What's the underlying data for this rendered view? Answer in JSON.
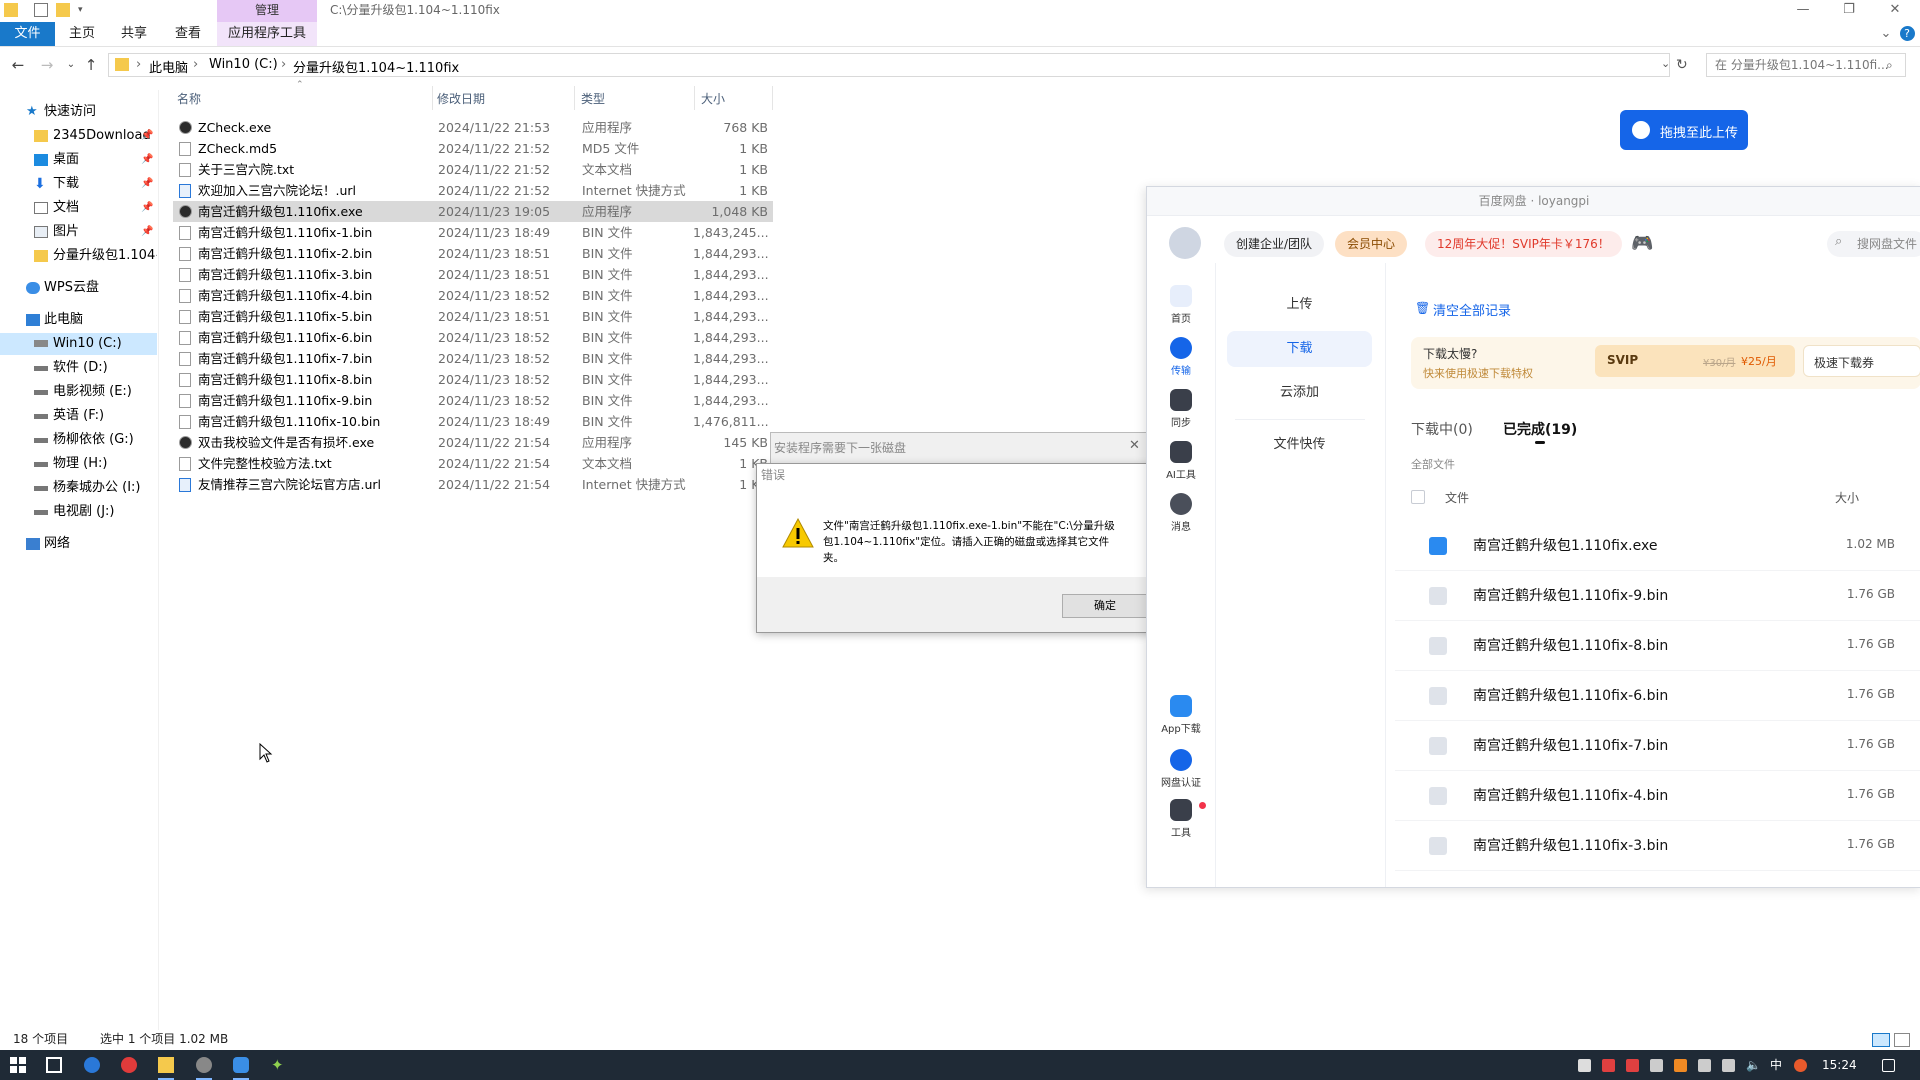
{
  "explorer": {
    "window_title": "C:\\分量升级包1.104~1.110fix",
    "context_tab_header": "管理",
    "ribbon_tabs": [
      "文件",
      "主页",
      "共享",
      "查看",
      "应用程序工具"
    ],
    "breadcrumb": [
      "此电脑",
      "Win10 (C:)",
      "分量升级包1.104~1.110fix"
    ],
    "search_placeholder": "在 分量升级包1.104~1.110fi...",
    "nav": {
      "quick_access": "快速访问",
      "pinned": [
        "2345Download",
        "桌面",
        "下载",
        "文档",
        "图片",
        "分量升级包1.104~1"
      ],
      "wps": "WPS云盘",
      "this_pc": "此电脑",
      "drives": [
        "Win10 (C:)",
        "软件 (D:)",
        "电影视频 (E:)",
        "英语 (F:)",
        "杨柳依依 (G:)",
        "物理 (H:)",
        "杨秦城办公 (I:)",
        "电视剧 (J:)"
      ],
      "network": "网络"
    },
    "columns": [
      "名称",
      "修改日期",
      "类型",
      "大小"
    ],
    "files": [
      {
        "name": "ZCheck.exe",
        "date": "2024/11/22 21:53",
        "type": "应用程序",
        "size": "768 KB"
      },
      {
        "name": "ZCheck.md5",
        "date": "2024/11/22 21:52",
        "type": "MD5 文件",
        "size": "1 KB"
      },
      {
        "name": "关于三宫六院.txt",
        "date": "2024/11/22 21:52",
        "type": "文本文档",
        "size": "1 KB"
      },
      {
        "name": "欢迎加入三宫六院论坛！.url",
        "date": "2024/11/22 21:52",
        "type": "Internet 快捷方式",
        "size": "1 KB"
      },
      {
        "name": "南宫迁鹤升级包1.110fix.exe",
        "date": "2024/11/23 19:05",
        "type": "应用程序",
        "size": "1,048 KB"
      },
      {
        "name": "南宫迁鹤升级包1.110fix-1.bin",
        "date": "2024/11/23 18:49",
        "type": "BIN 文件",
        "size": "1,843,245..."
      },
      {
        "name": "南宫迁鹤升级包1.110fix-2.bin",
        "date": "2024/11/23 18:51",
        "type": "BIN 文件",
        "size": "1,844,293..."
      },
      {
        "name": "南宫迁鹤升级包1.110fix-3.bin",
        "date": "2024/11/23 18:51",
        "type": "BIN 文件",
        "size": "1,844,293..."
      },
      {
        "name": "南宫迁鹤升级包1.110fix-4.bin",
        "date": "2024/11/23 18:52",
        "type": "BIN 文件",
        "size": "1,844,293..."
      },
      {
        "name": "南宫迁鹤升级包1.110fix-5.bin",
        "date": "2024/11/23 18:51",
        "type": "BIN 文件",
        "size": "1,844,293..."
      },
      {
        "name": "南宫迁鹤升级包1.110fix-6.bin",
        "date": "2024/11/23 18:52",
        "type": "BIN 文件",
        "size": "1,844,293..."
      },
      {
        "name": "南宫迁鹤升级包1.110fix-7.bin",
        "date": "2024/11/23 18:52",
        "type": "BIN 文件",
        "size": "1,844,293..."
      },
      {
        "name": "南宫迁鹤升级包1.110fix-8.bin",
        "date": "2024/11/23 18:52",
        "type": "BIN 文件",
        "size": "1,844,293..."
      },
      {
        "name": "南宫迁鹤升级包1.110fix-9.bin",
        "date": "2024/11/23 18:52",
        "type": "BIN 文件",
        "size": "1,844,293..."
      },
      {
        "name": "南宫迁鹤升级包1.110fix-10.bin",
        "date": "2024/11/23 18:49",
        "type": "BIN 文件",
        "size": "1,476,811..."
      },
      {
        "name": "双击我校验文件是否有损坏.exe",
        "date": "2024/11/22 21:54",
        "type": "应用程序",
        "size": "145 KB"
      },
      {
        "name": "文件完整性校验方法.txt",
        "date": "2024/11/22 21:54",
        "type": "文本文档",
        "size": "1 KB"
      },
      {
        "name": "友情推荐三宫六院论坛官方店.url",
        "date": "2024/11/22 21:54",
        "type": "Internet 快捷方式",
        "size": "1 KB"
      }
    ],
    "selected_index": 4,
    "status": {
      "count": "18 个项目",
      "selected": "选中 1 个项目  1.02 MB"
    }
  },
  "dialogs": {
    "back_title": "安装程序需要下一张磁盘",
    "title": "错误",
    "message": "文件\"南宫迁鹤升级包1.110fix.exe-1.bin\"不能在\"C:\\分量升级包1.104~1.110fix\"定位。请插入正确的磁盘或选择其它文件夹。",
    "ok": "确定"
  },
  "baidu": {
    "drag_upload": "拖拽至此上传",
    "window_title": "百度网盘 · loyangpi",
    "header": {
      "create_team": "创建企业/团队",
      "vip_center": "会员中心",
      "promo": "12周年大促！SVIP年卡￥176！",
      "search_placeholder": "搜网盘文件"
    },
    "side": [
      "首页",
      "传输",
      "同步",
      "AI工具",
      "消息",
      "App下载",
      "网盘认证",
      "工具"
    ],
    "transfer_tabs": [
      "上传",
      "下载",
      "云添加",
      "文件快传"
    ],
    "clear_all": "清空全部记录",
    "promo_card": {
      "title": "下载太慢?",
      "sub": "快来使用极速下载特权",
      "svip": "SVIP",
      "old_price": "¥30/月",
      "price": "¥25/月",
      "coupon": "极速下载券"
    },
    "subtabs": {
      "downloading": "下载中(0)",
      "done": "已完成(19)"
    },
    "all_files": "全部文件",
    "col_file": "文件",
    "col_size": "大小",
    "rows": [
      {
        "name": "南宫迁鹤升级包1.110fix.exe",
        "size": "1.02 MB"
      },
      {
        "name": "南宫迁鹤升级包1.110fix-9.bin",
        "size": "1.76 GB"
      },
      {
        "name": "南宫迁鹤升级包1.110fix-8.bin",
        "size": "1.76 GB"
      },
      {
        "name": "南宫迁鹤升级包1.110fix-6.bin",
        "size": "1.76 GB"
      },
      {
        "name": "南宫迁鹤升级包1.110fix-7.bin",
        "size": "1.76 GB"
      },
      {
        "name": "南宫迁鹤升级包1.110fix-4.bin",
        "size": "1.76 GB"
      },
      {
        "name": "南宫迁鹤升级包1.110fix-3.bin",
        "size": "1.76 GB"
      }
    ]
  },
  "taskbar": {
    "clock": "15:24",
    "ime": "中"
  },
  "colors": {
    "ribbon_file": "#1979ca",
    "baidu_blue": "#1565e8",
    "selection": "#cce8ff"
  }
}
